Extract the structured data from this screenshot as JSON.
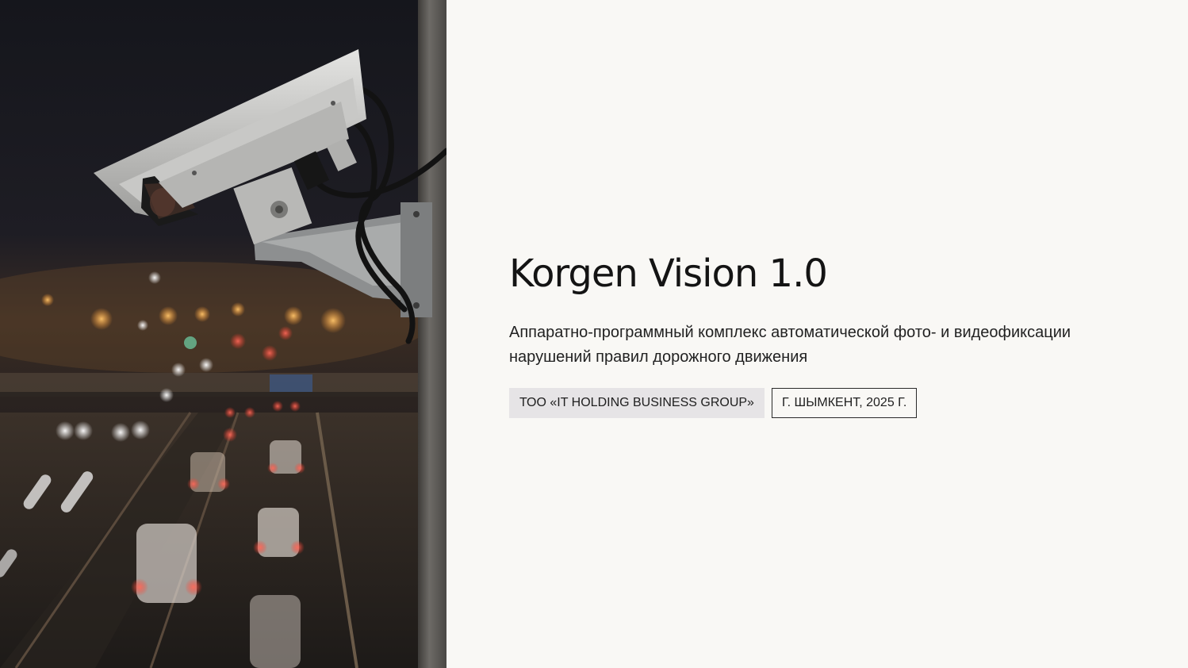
{
  "slide": {
    "title": "Korgen Vision 1.0",
    "subtitle": "Аппаратно-программный комплекс автоматической фото- и видеофиксации нарушений правил дорожного движения",
    "badges": [
      {
        "label": "ТОО «IT HOLDING BUSINESS GROUP»",
        "style": "filled"
      },
      {
        "label": "Г. ШЫМКЕНТ, 2025 Г.",
        "style": "outline"
      }
    ]
  },
  "image": {
    "subject": "traffic-camera-over-highway-night"
  },
  "colors": {
    "background": "#f9f8f5",
    "text": "#141414",
    "badge_fill": "#e6e4e6",
    "badge_border": "#2a2a2a"
  }
}
